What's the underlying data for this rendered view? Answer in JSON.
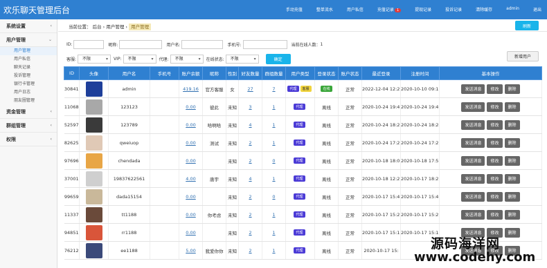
{
  "app": {
    "title": "欢乐聊天管理后台"
  },
  "topnav": [
    {
      "label": "手动充值"
    },
    {
      "label": "整单流水"
    },
    {
      "label": "用户私信"
    },
    {
      "label": "充值记录",
      "badge": "1"
    },
    {
      "label": "提现记录"
    },
    {
      "label": "投诉记录"
    },
    {
      "label": "清除缓存"
    },
    {
      "label": "admin"
    },
    {
      "label": "退出"
    }
  ],
  "sidebar": {
    "groups": [
      {
        "label": "系统设置",
        "chevron": "‹"
      },
      {
        "label": "用户管理",
        "chevron": "⌄",
        "items": [
          "用户管理",
          "用户私信",
          "聊天记录",
          "投诉管理",
          "银行卡管理",
          "用户日志",
          "朋友圈管理"
        ]
      },
      {
        "label": "资金管理",
        "chevron": "‹"
      },
      {
        "label": "群组管理",
        "chevron": "‹"
      },
      {
        "label": "权限",
        "chevron": "‹"
      }
    ]
  },
  "breadcrumb": {
    "prefix": "当前位置：",
    "l1": "后台",
    "l2": "用户管理",
    "current": "用户管理",
    "sep": "›"
  },
  "buttons": {
    "refresh": "刷新",
    "add_user": "新增用户",
    "confirm": "确定"
  },
  "filters": {
    "id_label": "ID:",
    "nickname_label": "昵称:",
    "username_label": "用户名:",
    "phone_label": "手机号:",
    "online_count_label": "当前在线人数：",
    "online_count": "1",
    "anchor_label": "客服:",
    "anchor_value": "不限",
    "vip_label": "VIP:",
    "vip_value": "不限",
    "agent_label": "代理:",
    "agent_value": "不限",
    "status_label": "在线状态:",
    "status_value": "不限"
  },
  "table": {
    "headers": [
      "ID",
      "头像",
      "用户名",
      "手机号",
      "账户余额",
      "昵称",
      "性别",
      "好友数量",
      "群组数量",
      "用户类型",
      "登录状态",
      "账户状态",
      "最近登录",
      "注册时间",
      "基本操作"
    ],
    "rows": [
      {
        "id": "30841",
        "avatar": "#1e3f9a",
        "username": "admin",
        "phone": "",
        "balance": "419.16",
        "nickname": "官方客服",
        "gender": "女",
        "friends": "27",
        "groups": "7",
        "types": [
          {
            "label": "代理",
            "kind": "agent"
          },
          {
            "label": "客服",
            "kind": "anchor"
          }
        ],
        "login": "在线",
        "login_online": true,
        "account": "正常",
        "last_login": "2022-12-04 12:29",
        "reg_time": "2020-10-10 09:18"
      },
      {
        "id": "11068",
        "avatar": "#a8a8a8",
        "username": "123123",
        "phone": "",
        "balance": "0.00",
        "nickname": "彼此",
        "gender": "未知",
        "friends": "3",
        "groups": "1",
        "types": [
          {
            "label": "代理",
            "kind": "agent"
          }
        ],
        "login": "离线",
        "login_online": false,
        "account": "正常",
        "last_login": "2020-10-24 19:49",
        "reg_time": "2020-10-24 19:49"
      },
      {
        "id": "52597",
        "avatar": "#3a3a3a",
        "username": "123789",
        "phone": "",
        "balance": "0.00",
        "nickname": "哈啊哈",
        "gender": "未知",
        "friends": "4",
        "groups": "1",
        "types": [
          {
            "label": "代理",
            "kind": "agent"
          }
        ],
        "login": "离线",
        "login_online": false,
        "account": "正常",
        "last_login": "2020-10-24 18:24",
        "reg_time": "2020-10-24 18:24"
      },
      {
        "id": "82625",
        "avatar": "#e0c9b6",
        "username": "qweiuop",
        "phone": "",
        "balance": "0.00",
        "nickname": "测试",
        "gender": "未知",
        "friends": "2",
        "groups": "1",
        "types": [
          {
            "label": "代理",
            "kind": "agent"
          }
        ],
        "login": "离线",
        "login_online": false,
        "account": "正常",
        "last_login": "2020-10-24 17:23",
        "reg_time": "2020-10-24 17:23"
      },
      {
        "id": "97696",
        "avatar": "#e8a646",
        "username": "chendada",
        "phone": "",
        "balance": "0.00",
        "nickname": "",
        "gender": "未知",
        "friends": "2",
        "groups": "0",
        "types": [
          {
            "label": "代理",
            "kind": "agent"
          }
        ],
        "login": "离线",
        "login_online": false,
        "account": "正常",
        "last_login": "2020-10-18 18:09",
        "reg_time": "2020-10-18 17:56"
      },
      {
        "id": "37001",
        "avatar": "#cfcfcf",
        "username": "19837622561",
        "phone": "",
        "balance": "4.00",
        "nickname": "唐宇",
        "gender": "未知",
        "friends": "4",
        "groups": "1",
        "types": [
          {
            "label": "代理",
            "kind": "agent"
          }
        ],
        "login": "离线",
        "login_online": false,
        "account": "正常",
        "last_login": "2020-10-18 12:23",
        "reg_time": "2020-10-17 18:23"
      },
      {
        "id": "99659",
        "avatar": "#c9b89a",
        "username": "dada15154",
        "phone": "",
        "balance": "0.00",
        "nickname": "",
        "gender": "未知",
        "friends": "2",
        "groups": "0",
        "types": [
          {
            "label": "代理",
            "kind": "agent"
          }
        ],
        "login": "离线",
        "login_online": false,
        "account": "正常",
        "last_login": "2020-10-17 15:49",
        "reg_time": "2020-10-17 15:49"
      },
      {
        "id": "11337",
        "avatar": "#6a4a3a",
        "username": "tt1188",
        "phone": "",
        "balance": "0.00",
        "nickname": "你考虑",
        "gender": "未知",
        "friends": "2",
        "groups": "1",
        "types": [
          {
            "label": "代理",
            "kind": "agent"
          }
        ],
        "login": "离线",
        "login_online": false,
        "account": "正常",
        "last_login": "2020-10-17 15:21",
        "reg_time": "2020-10-17 15:21"
      },
      {
        "id": "94851",
        "avatar": "#d9553a",
        "username": "rr1188",
        "phone": "",
        "balance": "0.00",
        "nickname": "",
        "gender": "未知",
        "friends": "2",
        "groups": "1",
        "types": [
          {
            "label": "代理",
            "kind": "agent"
          }
        ],
        "login": "离线",
        "login_online": false,
        "account": "正常",
        "last_login": "2020-10-17 15:12",
        "reg_time": "2020-10-17 15:12"
      },
      {
        "id": "76212",
        "avatar": "#3b4a7a",
        "username": "ee1188",
        "phone": "",
        "balance": "5.00",
        "nickname": "我爱你你",
        "gender": "未知",
        "friends": "2",
        "groups": "1",
        "types": [
          {
            "label": "代理",
            "kind": "agent"
          }
        ],
        "login": "离线",
        "login_online": false,
        "account": "正常",
        "last_login": "2020-10-17 15:",
        "reg_time": ""
      }
    ],
    "ops": [
      "发送消息",
      "修改",
      "删除"
    ]
  },
  "watermark": {
    "line1": "源码海洋网",
    "line2": "www.codehy.com"
  }
}
